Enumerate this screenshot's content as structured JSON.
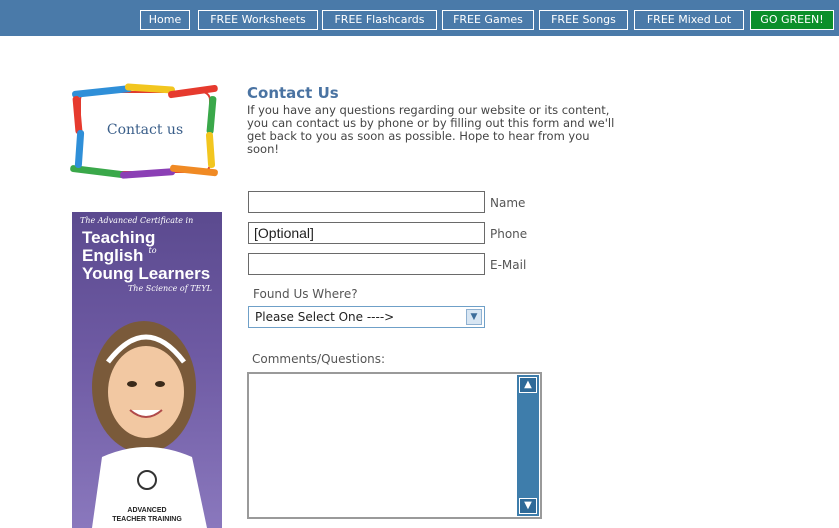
{
  "nav": {
    "items": [
      {
        "label": "Home"
      },
      {
        "label": "FREE Worksheets"
      },
      {
        "label": "FREE Flashcards"
      },
      {
        "label": "FREE Games"
      },
      {
        "label": "FREE Songs"
      },
      {
        "label": "FREE Mixed Lot"
      },
      {
        "label": "GO GREEN!"
      }
    ]
  },
  "logo": {
    "text": "Contact us"
  },
  "contact": {
    "title": "Contact Us",
    "intro": "If you have any questions regarding our website or its content, you can contact us by phone or by filling out this form and we'll get back to you as soon as possible. Hope to hear from you soon!"
  },
  "form": {
    "name_label": "Name",
    "name_value": "",
    "phone_label": "Phone",
    "phone_value": "[Optional]",
    "email_label": "E-Mail",
    "email_value": "",
    "found_label": "Found Us Where?",
    "found_selected": "Please Select One ---->",
    "comments_label": "Comments/Questions:"
  },
  "ad": {
    "line1": "The Advanced Certificate in",
    "line2": "Teaching",
    "line3": "English",
    "line3b": "to",
    "line4": "Young Learners",
    "line5": "The Science of TEYL",
    "brand1": "ADVANCED",
    "brand2": "TEACHER TRAINING"
  },
  "colors": {
    "nav_bg": "#4a7aa9",
    "go_green": "#0b8f2a",
    "title": "#4a73a2"
  }
}
